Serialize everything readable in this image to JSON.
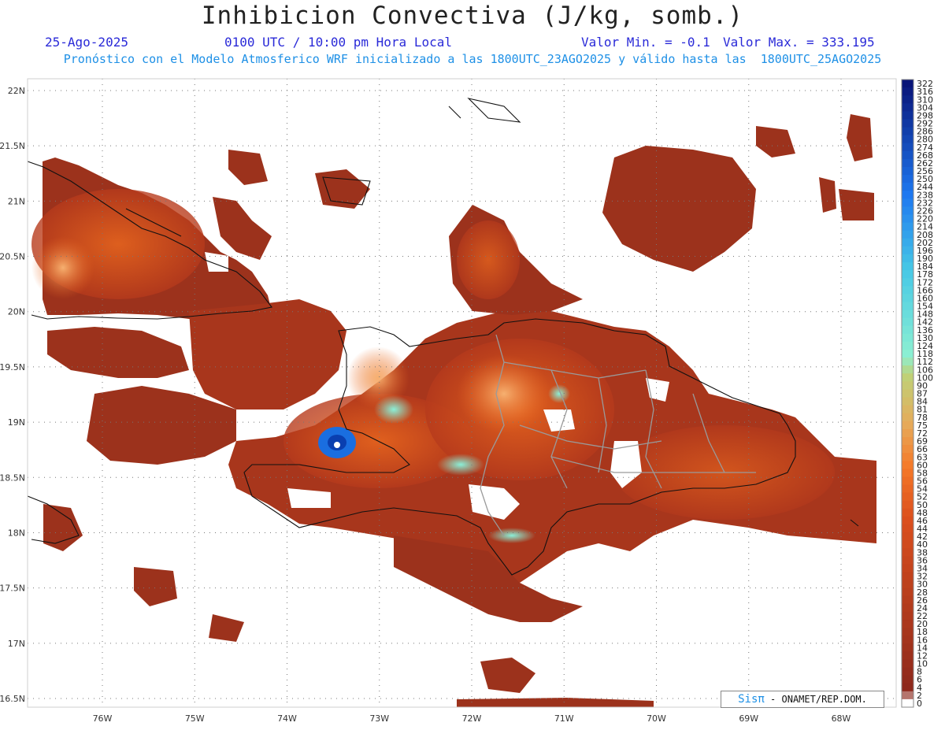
{
  "header": {
    "title": "Inhibicion Convectiva (J/kg, somb.)",
    "date": "25-Ago-2025",
    "time": "0100 UTC / 10:00 pm Hora Local",
    "valmin": "Valor Min. = -0.1",
    "valmax": "Valor Max. = 333.195",
    "forecast": "Pronóstico con el Modelo Atmosferico WRF inicializado a las 1800UTC_23AGO2025 y válido hasta las  1800UTC_25AGO2025"
  },
  "map": {
    "lat_labels": [
      "22N",
      "21.5N",
      "21N",
      "20.5N",
      "20N",
      "19.5N",
      "19N",
      "18.5N",
      "18N",
      "17.5N",
      "17N",
      "16.5N"
    ],
    "lon_labels": [
      "76W",
      "75W",
      "74W",
      "73W",
      "72W",
      "71W",
      "70W",
      "69W",
      "68W"
    ],
    "lat_values": [
      22,
      21.5,
      21,
      20.5,
      20,
      19.5,
      19,
      18.5,
      18,
      17.5,
      17,
      16.5
    ],
    "lon_values": [
      -76,
      -75,
      -74,
      -73,
      -72,
      -71,
      -70,
      -69,
      -68
    ],
    "colors": {
      "field_dark": "#8e2a1c",
      "field_mid": "#c9421b",
      "field_orange": "#ee6a1e",
      "field_light": "#f4a25a",
      "cyan": "#6ee6d8",
      "blue": "#1060d8",
      "coast": "#111111",
      "border": "#9a9a9a"
    }
  },
  "colorbar": {
    "labels": [
      "322",
      "316",
      "310",
      "304",
      "298",
      "292",
      "286",
      "280",
      "274",
      "268",
      "262",
      "256",
      "250",
      "244",
      "238",
      "232",
      "226",
      "220",
      "214",
      "208",
      "202",
      "196",
      "190",
      "184",
      "178",
      "172",
      "166",
      "160",
      "154",
      "148",
      "142",
      "136",
      "130",
      "124",
      "118",
      "112",
      "106",
      "100",
      "90",
      "87",
      "84",
      "81",
      "78",
      "75",
      "72",
      "69",
      "66",
      "63",
      "60",
      "58",
      "56",
      "54",
      "52",
      "50",
      "48",
      "46",
      "44",
      "42",
      "40",
      "38",
      "36",
      "34",
      "32",
      "30",
      "28",
      "26",
      "24",
      "22",
      "20",
      "18",
      "16",
      "14",
      "12",
      "10",
      "8",
      "6",
      "4",
      "2",
      "0"
    ]
  },
  "credit": {
    "brand": "Sisπ",
    "org": " - ONAMET/REP.DOM."
  }
}
